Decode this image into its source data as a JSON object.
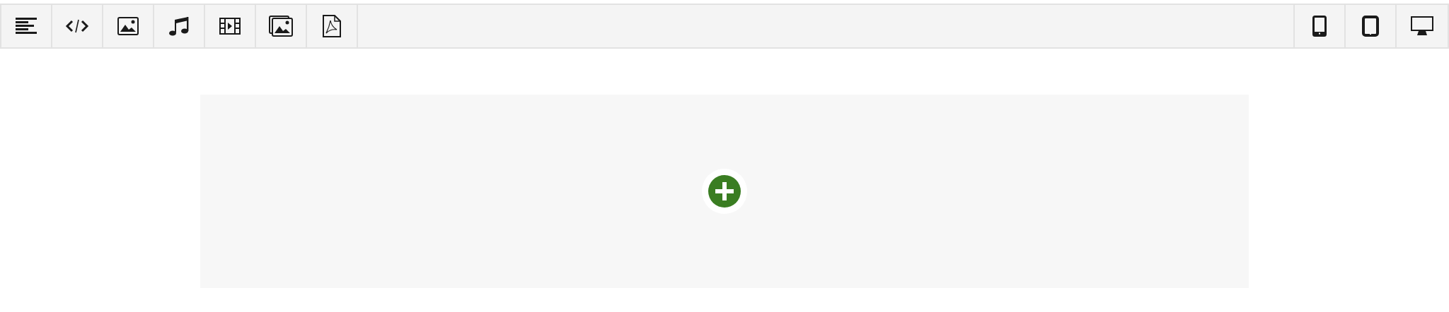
{
  "toolbar": {
    "blocks": [
      {
        "kind": "text"
      },
      {
        "kind": "code"
      },
      {
        "kind": "image"
      },
      {
        "kind": "audio"
      },
      {
        "kind": "video"
      },
      {
        "kind": "gallery"
      },
      {
        "kind": "pdf"
      }
    ],
    "devices": [
      {
        "kind": "phone"
      },
      {
        "kind": "tablet"
      },
      {
        "kind": "desktop"
      }
    ]
  },
  "canvas": {
    "add_button": {
      "kind": "add"
    }
  }
}
